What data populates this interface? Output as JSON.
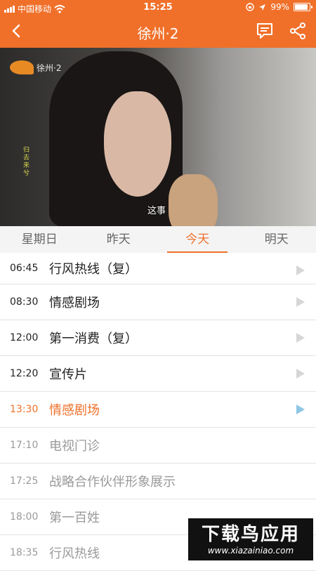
{
  "status_bar": {
    "carrier": "中国移动",
    "time": "15:25",
    "battery": "99%",
    "battery_level": 0.99
  },
  "nav": {
    "title": "徐州·2"
  },
  "video": {
    "channel_logo_text": "徐州·2",
    "vertical_text": "归去来兮",
    "subtitle": "这事"
  },
  "tabs": [
    {
      "label": "星期日"
    },
    {
      "label": "昨天"
    },
    {
      "label": "今天"
    },
    {
      "label": "明天"
    }
  ],
  "schedule": [
    {
      "time": "06:45",
      "name": "行风热线（复）"
    },
    {
      "time": "08:30",
      "name": "情感剧场"
    },
    {
      "time": "12:00",
      "name": "第一消费（复）"
    },
    {
      "time": "12:20",
      "name": "宣传片"
    },
    {
      "time": "13:30",
      "name": "情感剧场"
    },
    {
      "time": "17:10",
      "name": "电视门诊"
    },
    {
      "time": "17:25",
      "name": "战略合作伙伴形象展示"
    },
    {
      "time": "18:00",
      "name": "第一百姓"
    },
    {
      "time": "18:35",
      "name": "行风热线"
    }
  ],
  "watermark": {
    "title": "下载鸟应用",
    "url": "www.xiazainiao.com"
  }
}
